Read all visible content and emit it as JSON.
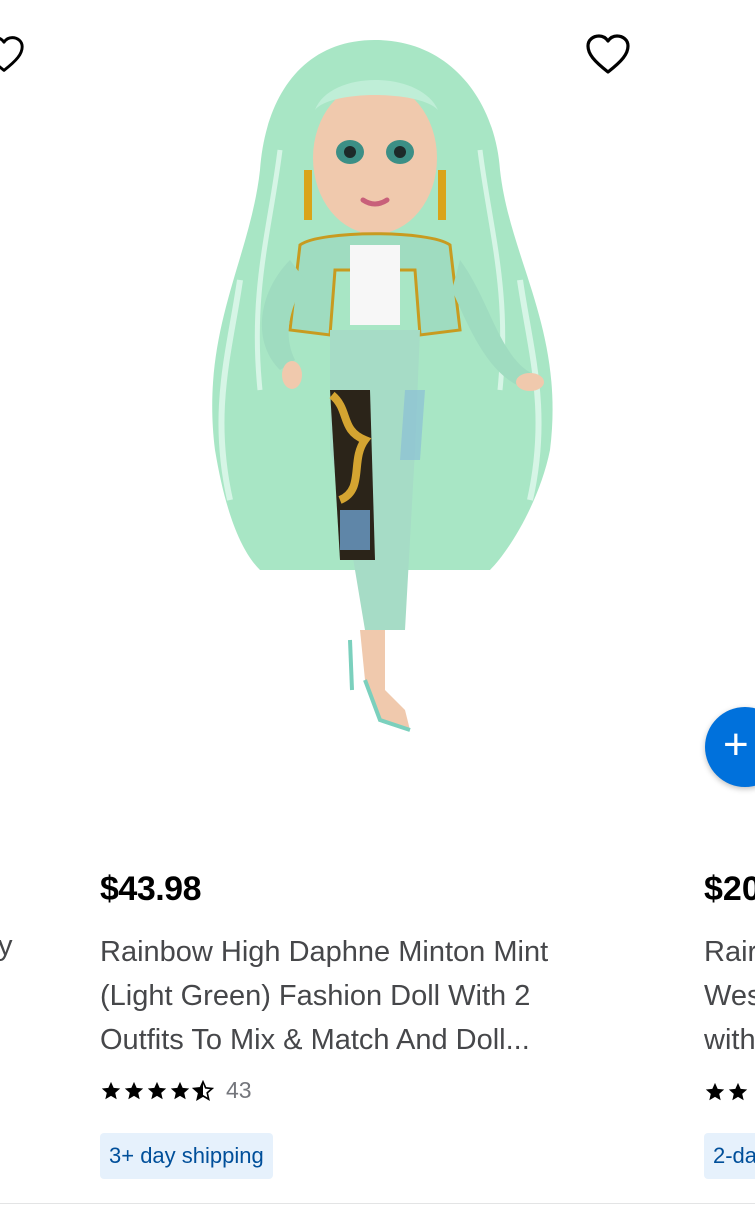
{
  "left_card": {
    "title_fragment": "y"
  },
  "main_card": {
    "price": "$43.98",
    "title_lines": [
      "Rainbow High Daphne Minton Mint",
      "(Light Green) Fashion Doll With 2",
      "Outfits To Mix & Match And Doll..."
    ],
    "rating": 4.5,
    "review_count": "43",
    "shipping_badge": "3+ day shipping",
    "add_button_icon": "plus-icon",
    "favorite_icon": "heart-outline-icon",
    "image": "doll-photo"
  },
  "right_card": {
    "price_fragment": "$20",
    "title_lines": [
      "Rair",
      "Wes",
      "with"
    ],
    "shipping_badge_fragment": "2-da"
  },
  "colors": {
    "accent": "#0071dc",
    "badge_bg": "#e6f1fc",
    "badge_text": "#004f9a",
    "star": "#000000"
  }
}
